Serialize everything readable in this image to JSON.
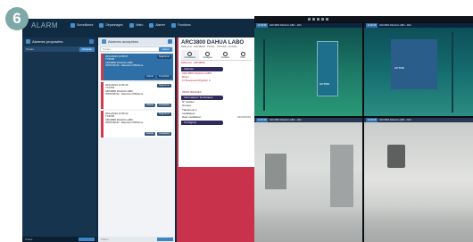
{
  "step_number": "6",
  "app": {
    "brand": "ALARM",
    "menu": [
      {
        "label": "Surveillance",
        "icon": "monitor-icon"
      },
      {
        "label": "Dépannages",
        "icon": "wrench-icon"
      },
      {
        "label": "Vidéo",
        "icon": "video-icon"
      },
      {
        "label": "Alarme",
        "icon": "bell-icon"
      },
      {
        "label": "Fonctions",
        "icon": "list-icon"
      }
    ]
  },
  "proposed": {
    "title": "Alarmes proposées",
    "filter_placeholder": "Toutes",
    "filter_button": "Accepter",
    "footer_label": "Toutes"
  },
  "accepted": {
    "title": "Alarmes acceptées",
    "filter_placeholder": "Toutes",
    "filter_button": "Libérer",
    "footer_label": "Libérer",
    "cards": [
      {
        "date": "26/11/2019 13:58:37",
        "id": "77/8745",
        "site": "ARC3800 DAHUA LABO",
        "detail": "INTRUSION - Détection PIR/Zone",
        "action1": "Libérer",
        "action2": "Transférer",
        "pill": "Supprimer"
      },
      {
        "date": "26/11/2019 13:45:49",
        "id": "77/4763",
        "site": "ARC3800 DAHUA LABO",
        "detail": "INTRUSION - Détection PIR/Zone",
        "action1": "Libérer",
        "action2": "Transférer",
        "pill": "Supprimer"
      },
      {
        "date": "26/11/2019 13:35:22",
        "id": "77/8745",
        "site": "ARC3800 DAHUA LABO",
        "detail": "INTRUSION - Détection PIR/Zone",
        "action1": "Libérer",
        "action2": "Transférer",
        "pill": "Supprimer"
      }
    ]
  },
  "detail": {
    "title": "ARC3800 DAHUA LABO",
    "reference": "Référence : ARC3800A - Priorité : 77/0745A - Contrôle",
    "tabs": [
      "Informations",
      "Consignes",
      "Contacts",
      "Histo"
    ],
    "sub": "Référence : ARC3800A",
    "address_header": "Adresse",
    "address_lines": [
      "ARC3800 DAHUA LABO",
      "Bravo",
      "11 Boulevard Rigollier 3",
      "",
      "",
      "35000 RENNES"
    ],
    "tech_header": "Informations Techniques",
    "tech_rows": [
      {
        "k": "N° dossier",
        "v": ""
      },
      {
        "k": "Groupe",
        "v": ""
      },
      {
        "k": "Téléphone 1",
        "v": ""
      },
      {
        "k": "Installateur",
        "v": ""
      },
      {
        "k": "Date installation",
        "v": "03/03/2019"
      }
    ],
    "consignes_header": "Consignes"
  },
  "video_wall": {
    "cameras": [
      {
        "time": "11:09:38",
        "label": "ARC3800 DAHUA LABO - ARC"
      },
      {
        "time": "11:09:38",
        "label": "ARC3800 DAHUA LABO - ARC"
      },
      {
        "time": "11:09:38",
        "label": "ARC3800 DAHUA LABO - ARC"
      },
      {
        "time": "11:09:38",
        "label": "ARC3800 DAHUA LABO - ARC"
      }
    ],
    "panel_text": "ACTIVE"
  }
}
